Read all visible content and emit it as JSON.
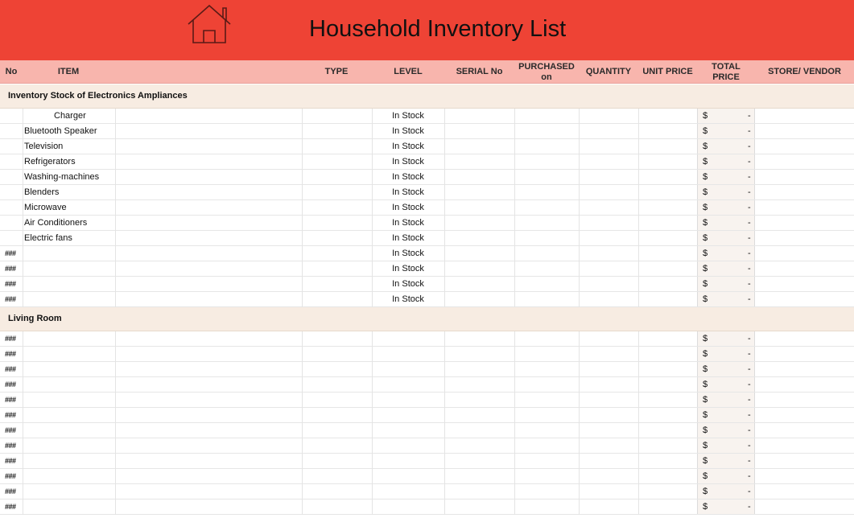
{
  "title": "Household Inventory List",
  "icon": "house-icon",
  "colors": {
    "banner": "#ee4335",
    "header": "#f8b5ad",
    "section": "#f7ece2"
  },
  "columns": [
    "No",
    "ITEM",
    "TYPE",
    "LEVEL",
    "SERIAL No",
    "PURCHASED on",
    "QUANTITY",
    "UNIT PRICE",
    "TOTAL PRICE",
    "STORE/ VENDOR"
  ],
  "sections": [
    {
      "name": "Inventory Stock of Electronics Ampliances",
      "rows": [
        {
          "no": "",
          "item": "Charger",
          "level": "In Stock",
          "currency": "$",
          "total": "-"
        },
        {
          "no": "",
          "item": "Bluetooth Speaker",
          "level": "In Stock",
          "currency": "$",
          "total": "-"
        },
        {
          "no": "",
          "item": "Television",
          "level": "In Stock",
          "currency": "$",
          "total": "-"
        },
        {
          "no": "",
          "item": "Refrigerators",
          "level": "In Stock",
          "currency": "$",
          "total": "-"
        },
        {
          "no": "",
          "item": "Washing-machines",
          "level": "In Stock",
          "currency": "$",
          "total": "-"
        },
        {
          "no": "",
          "item": "Blenders",
          "level": "In Stock",
          "currency": "$",
          "total": "-"
        },
        {
          "no": "",
          "item": "Microwave",
          "level": "In Stock",
          "currency": "$",
          "total": "-"
        },
        {
          "no": "",
          "item": "Air  Conditioners",
          "level": "In Stock",
          "currency": "$",
          "total": "-"
        },
        {
          "no": "",
          "item": "Electric fans",
          "level": "In Stock",
          "currency": "$",
          "total": "-"
        },
        {
          "no": "###",
          "item": "",
          "level": "In Stock",
          "currency": "$",
          "total": "-"
        },
        {
          "no": "###",
          "item": "",
          "level": "In Stock",
          "currency": "$",
          "total": "-"
        },
        {
          "no": "###",
          "item": "",
          "level": "In Stock",
          "currency": "$",
          "total": "-"
        },
        {
          "no": "###",
          "item": "",
          "level": "In Stock",
          "currency": "$",
          "total": "-"
        }
      ]
    },
    {
      "name": "Living Room",
      "rows": [
        {
          "no": "###",
          "item": "",
          "level": "",
          "currency": "$",
          "total": "-"
        },
        {
          "no": "###",
          "item": "",
          "level": "",
          "currency": "$",
          "total": "-"
        },
        {
          "no": "###",
          "item": "",
          "level": "",
          "currency": "$",
          "total": "-"
        },
        {
          "no": "###",
          "item": "",
          "level": "",
          "currency": "$",
          "total": "-"
        },
        {
          "no": "###",
          "item": "",
          "level": "",
          "currency": "$",
          "total": "-"
        },
        {
          "no": "###",
          "item": "",
          "level": "",
          "currency": "$",
          "total": "-"
        },
        {
          "no": "###",
          "item": "",
          "level": "",
          "currency": "$",
          "total": "-"
        },
        {
          "no": "###",
          "item": "",
          "level": "",
          "currency": "$",
          "total": "-"
        },
        {
          "no": "###",
          "item": "",
          "level": "",
          "currency": "$",
          "total": "-"
        },
        {
          "no": "###",
          "item": "",
          "level": "",
          "currency": "$",
          "total": "-"
        },
        {
          "no": "###",
          "item": "",
          "level": "",
          "currency": "$",
          "total": "-"
        },
        {
          "no": "###",
          "item": "",
          "level": "",
          "currency": "$",
          "total": "-"
        }
      ]
    }
  ]
}
